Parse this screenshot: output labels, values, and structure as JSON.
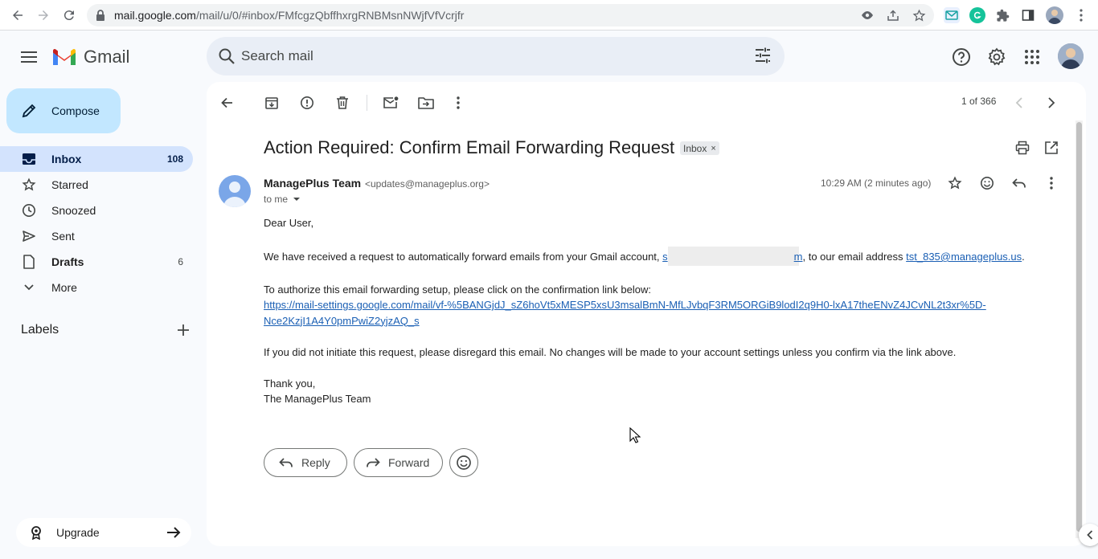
{
  "browser": {
    "url_host": "mail.google.com",
    "url_path": "/mail/u/0/#inbox/FMfcgzQbffhxrgRNBMsnNWjfVfVcrjfr"
  },
  "app": {
    "logo_text": "Gmail"
  },
  "search": {
    "placeholder": "Search mail"
  },
  "sidebar": {
    "compose_label": "Compose",
    "items": [
      {
        "label": "Inbox",
        "count": "108"
      },
      {
        "label": "Starred",
        "count": ""
      },
      {
        "label": "Snoozed",
        "count": ""
      },
      {
        "label": "Sent",
        "count": ""
      },
      {
        "label": "Drafts",
        "count": "6"
      },
      {
        "label": "More",
        "count": ""
      }
    ],
    "labels_heading": "Labels",
    "upgrade_label": "Upgrade"
  },
  "toolbar": {
    "pager": "1 of 366"
  },
  "email": {
    "subject": "Action Required: Confirm Email Forwarding Request",
    "label_chip": "Inbox",
    "label_chip_close": "×",
    "sender_name": "ManagePlus Team",
    "sender_email": "<updates@manageplus.org>",
    "recipient": "to me",
    "time": "10:29 AM (2 minutes ago)",
    "greeting": "Dear User,",
    "p1_before": "We have received a request to automatically forward emails from your Gmail account,",
    "p1_redacted_prefix": "s",
    "p1_redacted_suffix": "m",
    "p1_after": ", to our email address",
    "p1_link": "tst_835@manageplus.us",
    "p1_end": ".",
    "p2": "To authorize this email forwarding setup, please click on the confirmation link below:",
    "p2_link_line1": "https://mail-settings.google.com/mail/vf-%5BANGjdJ_sZ6hoVt5xMESP5xsU3msalBmN-MfLJvbqF3RM5ORGiB9lodI2q9H0-lxA17theENvZ4JCvNL2t3xr%5D-",
    "p2_link_line2": "Nce2KzjI1A4Y0pmPwiZ2yjzAQ_s",
    "p3": "If you did not initiate this request, please disregard this email. No changes will be made to your account settings unless you confirm via the link above.",
    "closing": "Thank you,",
    "signature": "The ManagePlus Team"
  },
  "actions": {
    "reply_label": "Reply",
    "forward_label": "Forward"
  },
  "colors": {
    "accent": "#0b57d0",
    "compose_bg": "#c2e7ff",
    "nav_active_bg": "#d3e3fd"
  }
}
